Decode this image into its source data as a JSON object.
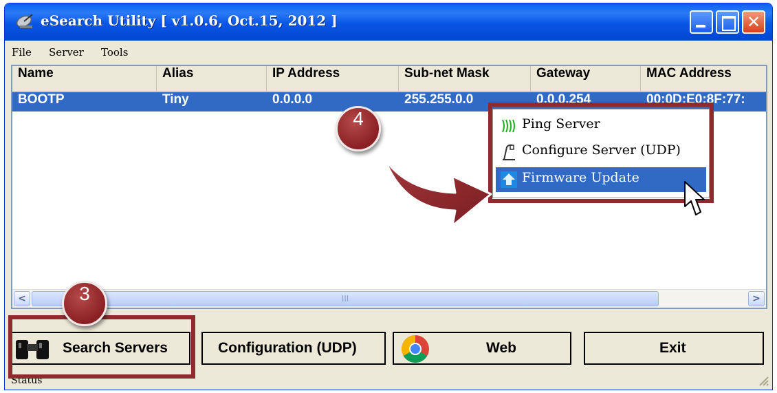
{
  "window": {
    "title": "eSearch Utility [ v1.0.6, Oct.15, 2012 ]",
    "title_icon": "satellite-dish-icon",
    "controls": {
      "minimize": "minimize-icon",
      "maximize": "maximize-icon",
      "close": "✕"
    }
  },
  "menubar": {
    "items": [
      "File",
      "Server",
      "Tools"
    ]
  },
  "table": {
    "columns": [
      "Name",
      "Alias",
      "IP Address",
      "Sub-net Mask",
      "Gateway",
      "MAC Address"
    ],
    "rows": [
      {
        "name": "BOOTP",
        "alias": "Tiny",
        "ip": "0.0.0.0",
        "subnet": "255.255.0.0",
        "gateway": "0.0.0.254",
        "mac": "00:0D:E0:8F:77:"
      }
    ],
    "scrollbar": {
      "left": "<",
      "thumb": "III",
      "right": ">"
    }
  },
  "context_menu": {
    "items": [
      {
        "label": "Ping Server",
        "icon": "ping-waves-icon"
      },
      {
        "label": "Configure Server (UDP)",
        "icon": "configure-icon"
      },
      {
        "label": "Firmware Update",
        "icon": "upload-icon",
        "selected": true
      }
    ]
  },
  "buttons": {
    "search": {
      "label": "Search Servers",
      "icon": "binoculars-icon"
    },
    "config": {
      "label": "Configuration (UDP)"
    },
    "web": {
      "label": "Web",
      "icon": "chrome-icon"
    },
    "exit": {
      "label": "Exit"
    }
  },
  "status": {
    "text": "Status"
  },
  "annotations": {
    "step3": "3",
    "step4": "4",
    "highlight_color": "#8f2a2f"
  }
}
